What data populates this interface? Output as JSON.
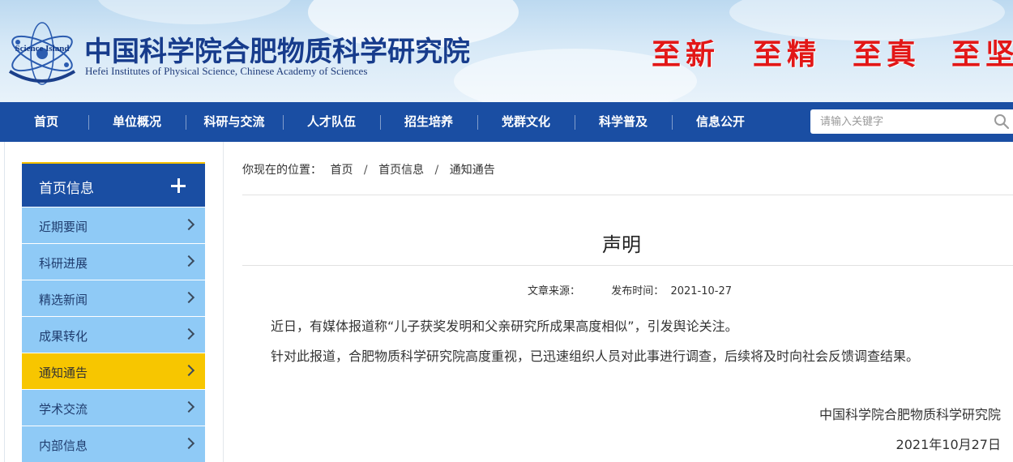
{
  "header": {
    "logo_text": "Science Island",
    "org_cn": "中国科学院合肥物质科学研究院",
    "org_en": "Hefei Institutes of Physical Science, Chinese Academy of Sciences",
    "motto": [
      "至新",
      "至精",
      "至真",
      "至坚"
    ]
  },
  "nav": {
    "items": [
      "首页",
      "单位概况",
      "科研与交流",
      "人才队伍",
      "招生培养",
      "党群文化",
      "科学普及",
      "信息公开"
    ],
    "search_placeholder": "请输入关键字"
  },
  "sidebar": {
    "title": "首页信息",
    "items": [
      {
        "label": "近期要闻",
        "active": false
      },
      {
        "label": "科研进展",
        "active": false
      },
      {
        "label": "精选新闻",
        "active": false
      },
      {
        "label": "成果转化",
        "active": false
      },
      {
        "label": "通知通告",
        "active": true
      },
      {
        "label": "学术交流",
        "active": false
      },
      {
        "label": "内部信息",
        "active": false
      }
    ]
  },
  "breadcrumb": {
    "prefix": "你现在的位置：",
    "items": [
      "首页",
      "首页信息",
      "通知通告"
    ],
    "separator": "/"
  },
  "article": {
    "title": "声明",
    "source_label": "文章来源：",
    "source_value": "",
    "date_label": "发布时间：",
    "date_value": "2021-10-27",
    "paragraphs": [
      "近日，有媒体报道称“儿子获奖发明和父亲研究所成果高度相似”，引发舆论关注。",
      "针对此报道，合肥物质科学研究院高度重视，已迅速组织人员对此事进行调查，后续将及时向社会反馈调查结果。"
    ],
    "signature_org": "中国科学院合肥物质科学研究院",
    "signature_date": "2021年10月27日"
  },
  "colors": {
    "nav_bg": "#1a4ea3",
    "sidebar_item_bg": "#8fcaf6",
    "sidebar_active_bg": "#f7c600",
    "motto_red": "#e21717"
  }
}
